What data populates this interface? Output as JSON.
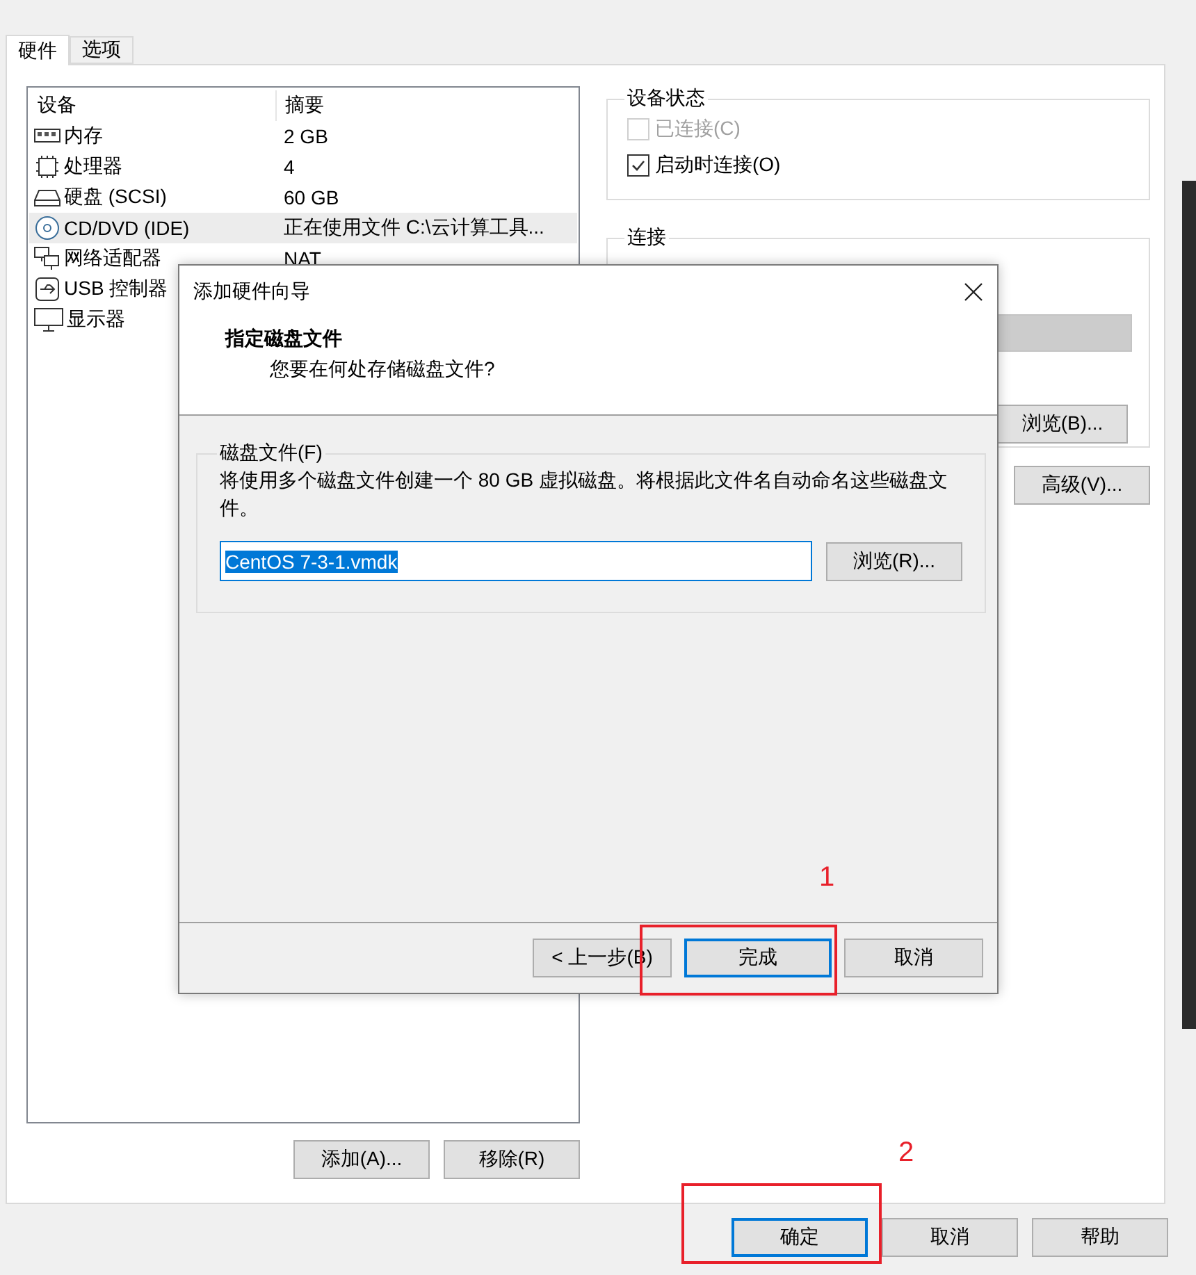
{
  "tabs": [
    {
      "label": "硬件",
      "selected": true
    },
    {
      "label": "选项",
      "selected": false
    }
  ],
  "device_table": {
    "columns": [
      "设备",
      "摘要"
    ],
    "rows": [
      {
        "kind": "memory",
        "device": "内存",
        "summary": "2 GB",
        "selected": false
      },
      {
        "kind": "cpu",
        "device": "处理器",
        "summary": "4",
        "selected": false
      },
      {
        "kind": "disk",
        "device": "硬盘 (SCSI)",
        "summary": "60 GB",
        "selected": false
      },
      {
        "kind": "cd",
        "device": "CD/DVD (IDE)",
        "summary": "正在使用文件 C:\\云计算工具...",
        "selected": true
      },
      {
        "kind": "network",
        "device": "网络适配器",
        "summary": "NAT",
        "selected": false
      },
      {
        "kind": "usb",
        "device": "USB 控制器",
        "selected": false
      },
      {
        "kind": "display",
        "device": "显示器",
        "selected": false
      }
    ]
  },
  "list_buttons": [
    "添加(A)...",
    "移除(R)"
  ],
  "device_status": {
    "title": "设备状态",
    "options": [
      {
        "label": "已连接(C)",
        "checked": false,
        "disabled": true
      },
      {
        "label": "启动时连接(O)",
        "checked": true,
        "disabled": false
      }
    ]
  },
  "connection": {
    "title": "连接",
    "browse_button": "浏览(B)..."
  },
  "advanced_button": "高级(V)...",
  "footer_buttons": [
    {
      "label": "确定",
      "default": true
    },
    {
      "label": "取消",
      "default": false
    },
    {
      "label": "帮助",
      "default": false
    }
  ],
  "wizard": {
    "title": "添加硬件向导",
    "heading": "指定磁盘文件",
    "subheading": "您要在何处存储磁盘文件?",
    "group_title": "磁盘文件(F)",
    "description": "将使用多个磁盘文件创建一个 80 GB 虚拟磁盘。将根据此文件名自动命名这些磁盘文件。",
    "file_name": "CentOS 7-3-1.vmdk",
    "browse_button": "浏览(R)...",
    "buttons": [
      {
        "label": "< 上一步(B)",
        "default": false
      },
      {
        "label": "完成",
        "default": true
      },
      {
        "label": "取消",
        "default": false
      }
    ]
  },
  "annotations": [
    {
      "label": "1"
    },
    {
      "label": "2"
    }
  ]
}
